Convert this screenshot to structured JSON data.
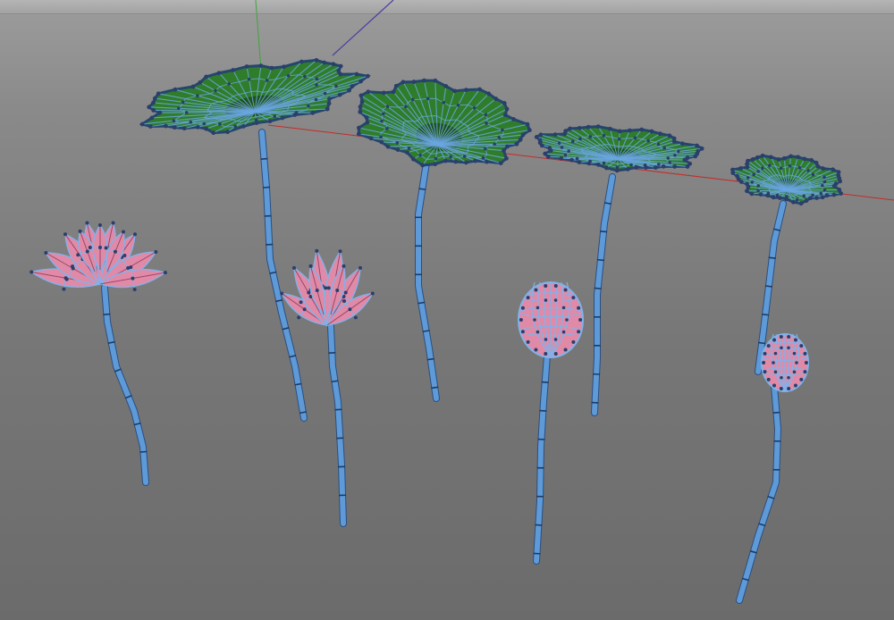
{
  "viewport": {
    "background": "#7a7a7a",
    "axis_colors": {
      "x": "#c62a2a",
      "y": "#3fa43f",
      "z": "#4a3e9e"
    }
  },
  "materials": {
    "leaf_fill": "#2f7d2a",
    "leaf_fill_dark": "#1d4f1b",
    "leaf_vein": "#6aa6e0",
    "petal_fill": "#e08aa8",
    "petal_dark": "#6b1d3c",
    "wire": "#7fb3ea",
    "stem": "#5e9ad8",
    "vertex": "#2c3e6a"
  },
  "objects": [
    {
      "kind": "leaf",
      "name": "lotus-leaf-1"
    },
    {
      "kind": "leaf",
      "name": "lotus-leaf-2"
    },
    {
      "kind": "leaf",
      "name": "lotus-leaf-3"
    },
    {
      "kind": "leaf",
      "name": "lotus-leaf-4"
    },
    {
      "kind": "flower",
      "name": "lotus-flower-open"
    },
    {
      "kind": "flower",
      "name": "lotus-flower-half-open"
    },
    {
      "kind": "bud",
      "name": "lotus-bud-large"
    },
    {
      "kind": "bud",
      "name": "lotus-bud-small"
    }
  ]
}
